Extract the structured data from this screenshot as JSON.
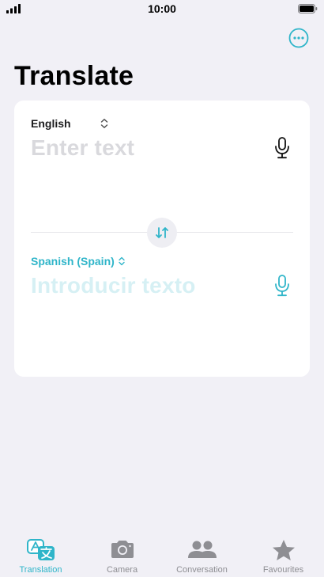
{
  "status_bar": {
    "time": "10:00"
  },
  "header": {
    "title": "Translate",
    "more_icon": "ellipsis-circle-icon"
  },
  "source": {
    "language": "English",
    "placeholder": "Enter text",
    "mic_icon": "microphone-icon"
  },
  "swap_icon": "swap-arrows-icon",
  "target": {
    "language": "Spanish (Spain)",
    "placeholder": "Introducir texto",
    "mic_icon": "microphone-icon"
  },
  "tabs": [
    {
      "label": "Translation",
      "icon": "translate-icon",
      "active": true
    },
    {
      "label": "Camera",
      "icon": "camera-icon",
      "active": false
    },
    {
      "label": "Conversation",
      "icon": "people-icon",
      "active": false
    },
    {
      "label": "Favourites",
      "icon": "star-icon",
      "active": false
    }
  ],
  "colors": {
    "accent": "#2fb5c9",
    "background": "#f1f0f6",
    "card": "#ffffff",
    "inactive": "#8e8e93"
  }
}
